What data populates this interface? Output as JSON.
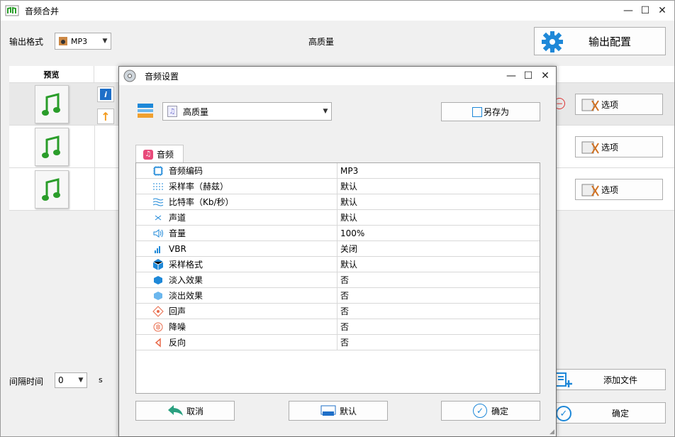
{
  "main": {
    "title": "音频合并",
    "output_format_label": "输出格式",
    "output_format_value": "MP3",
    "quality_label": "高质量",
    "output_config_button": "输出配置",
    "preview_header": "预览",
    "option_button": "选项",
    "interval_label": "间隔时间",
    "interval_value": "0",
    "interval_unit": "s",
    "add_file_button": "添加文件",
    "ok_button": "确定"
  },
  "dialog": {
    "title": "音频设置",
    "preset_value": "高质量",
    "save_as_button": "另存为",
    "tab_audio": "音频",
    "properties": [
      {
        "name": "音频编码",
        "value": "MP3",
        "icon": "chip-icon"
      },
      {
        "name": "采样率（赫兹）",
        "value": "默认",
        "icon": "sample-rate-icon"
      },
      {
        "name": "比特率（Kb/秒）",
        "value": "默认",
        "icon": "bitrate-wave-icon"
      },
      {
        "name": "声道",
        "value": "默认",
        "icon": "channel-icon"
      },
      {
        "name": "音量",
        "value": "100%",
        "icon": "volume-icon"
      },
      {
        "name": "VBR",
        "value": "关闭",
        "icon": "vbr-bars-icon"
      },
      {
        "name": "采样格式",
        "value": "默认",
        "icon": "cube-icon"
      },
      {
        "name": "淡入效果",
        "value": "否",
        "icon": "fade-in-icon"
      },
      {
        "name": "淡出效果",
        "value": "否",
        "icon": "fade-out-icon"
      },
      {
        "name": "回声",
        "value": "否",
        "icon": "echo-icon"
      },
      {
        "name": "降噪",
        "value": "否",
        "icon": "denoise-icon"
      },
      {
        "name": "反向",
        "value": "否",
        "icon": "reverse-icon"
      }
    ],
    "cancel_button": "取消",
    "default_button": "默认",
    "confirm_button": "确定"
  },
  "colors": {
    "accent": "#1e88d8",
    "green_note": "#2a9d2a",
    "pink_tab": "#e84a7a"
  }
}
